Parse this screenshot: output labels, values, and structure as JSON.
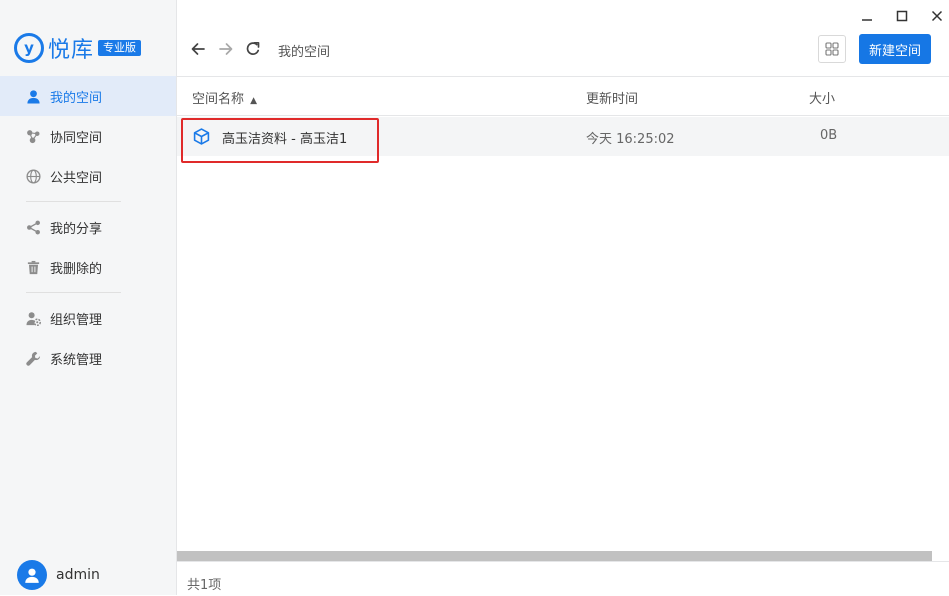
{
  "brand": {
    "mark": "y",
    "name": "悦库",
    "badge": "专业版"
  },
  "sidebar": {
    "items": [
      {
        "label": "我的空间",
        "icon": "person-icon"
      },
      {
        "label": "协同空间",
        "icon": "collaboration-icon"
      },
      {
        "label": "公共空间",
        "icon": "globe-icon"
      },
      {
        "label": "我的分享",
        "icon": "share-icon"
      },
      {
        "label": "我删除的",
        "icon": "trash-icon"
      },
      {
        "label": "组织管理",
        "icon": "org-settings-icon"
      },
      {
        "label": "系统管理",
        "icon": "wrench-icon"
      }
    ],
    "active_index": 0
  },
  "user": {
    "name": "admin"
  },
  "toolbar": {
    "breadcrumb": "我的空间",
    "new_button": "新建空间"
  },
  "table": {
    "headers": {
      "name": "空间名称",
      "updated": "更新时间",
      "size": "大小"
    },
    "sort_indicator": "▲",
    "rows": [
      {
        "name": "高玉洁资料 - 高玉洁1",
        "updated": "今天 16:25:02",
        "size": "0B"
      }
    ]
  },
  "footer": {
    "count": "共1项"
  },
  "colors": {
    "accent": "#1a7ae8",
    "highlight": "#e02a2a"
  }
}
